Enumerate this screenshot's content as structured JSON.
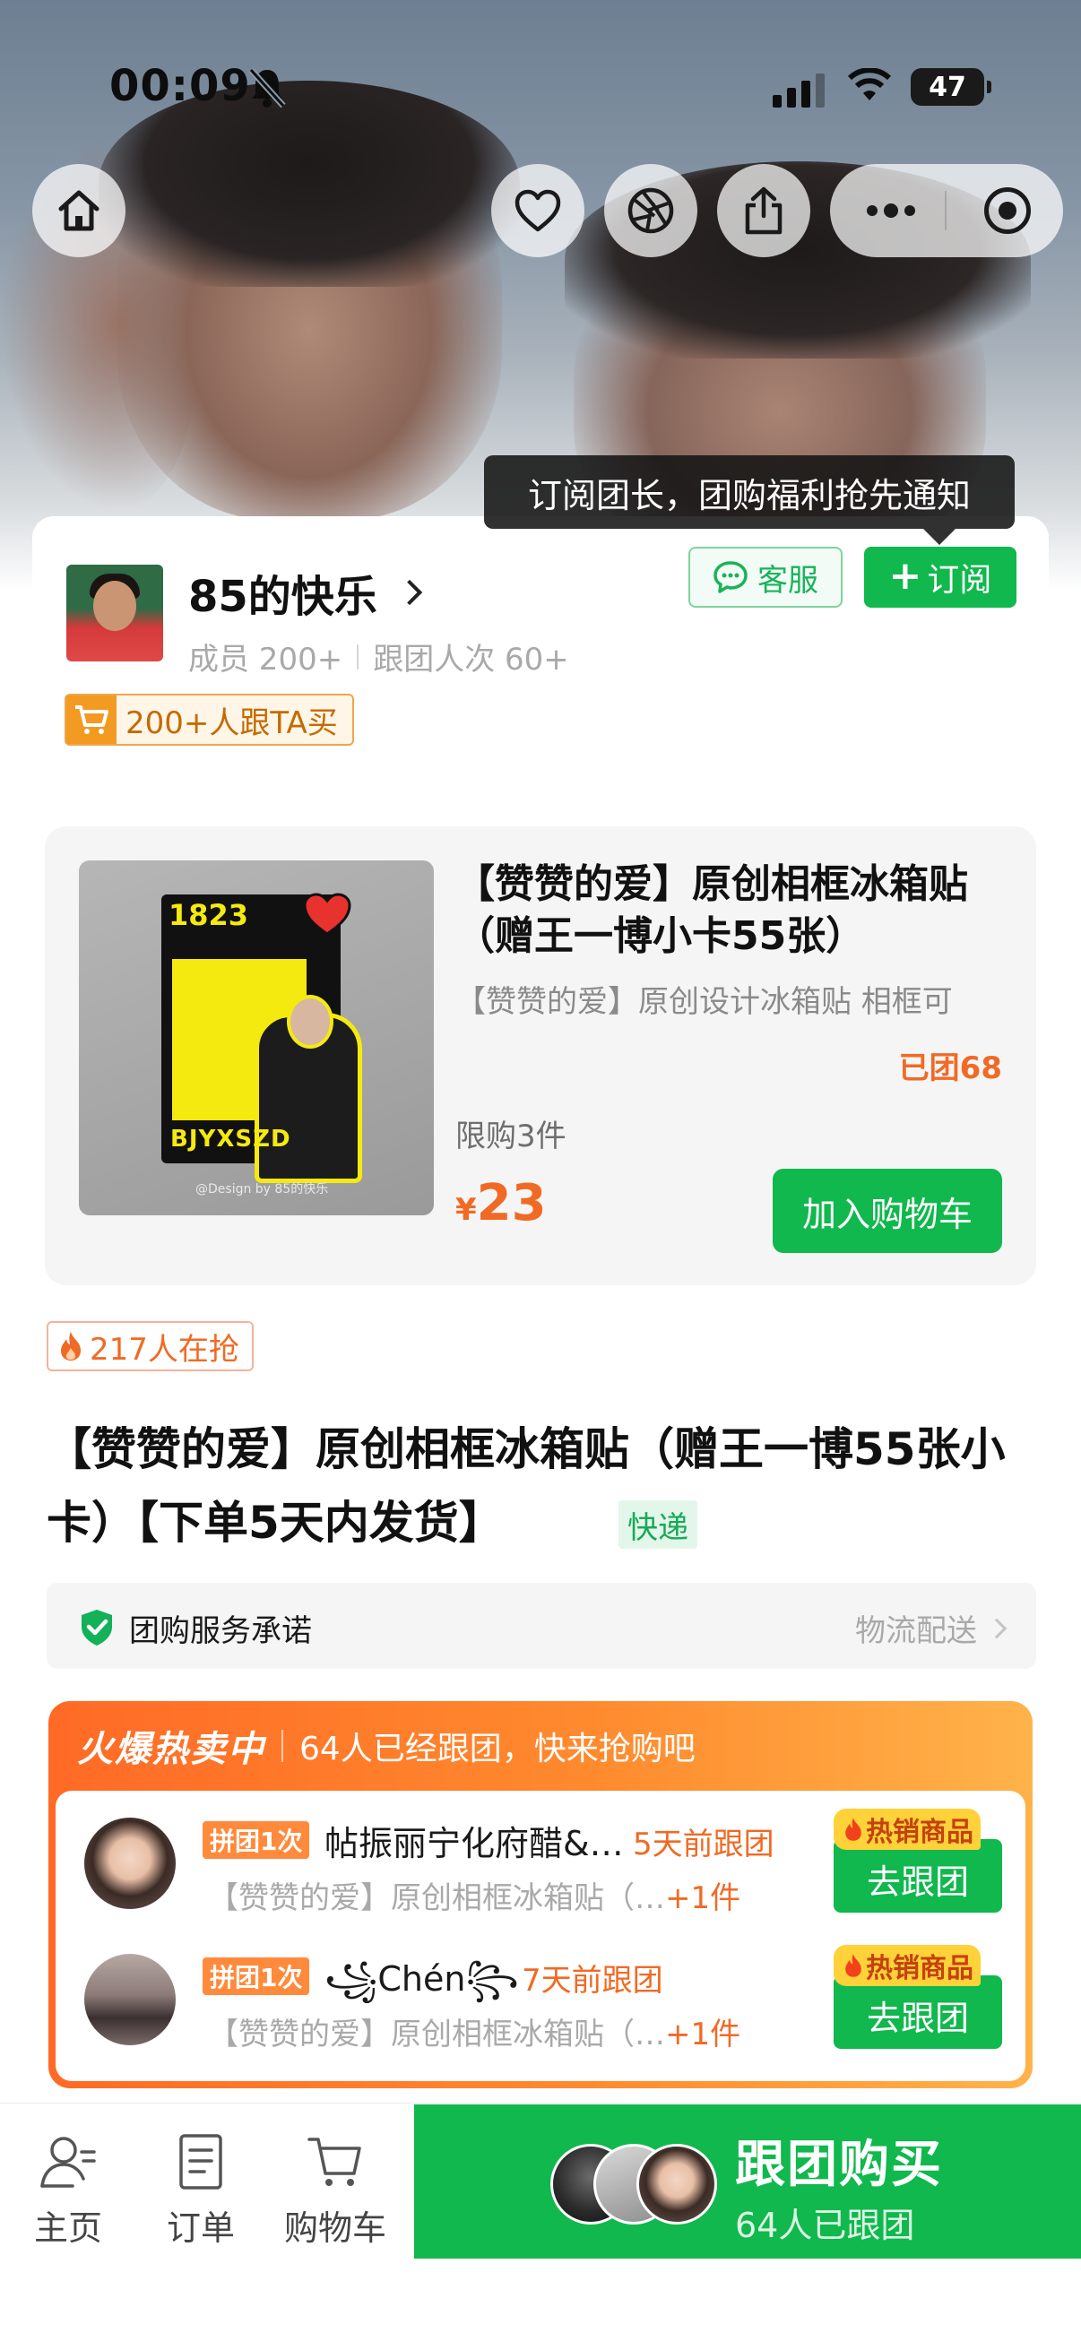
{
  "status_bar": {
    "time": "00:09",
    "battery": "47"
  },
  "tooltip": "订阅团长，团购福利抢先通知",
  "leader": {
    "name": "85的快乐",
    "members": "成员 200+",
    "followers": "跟团人次 60+",
    "buy_badge": "200+人跟TA买",
    "service_label": "客服",
    "subscribe_label": "订阅"
  },
  "product": {
    "thumb_text": {
      "year": "1823",
      "bottom": "BJYXSZD",
      "credit": "@Design by 85的快乐"
    },
    "title": "【赞赞的爱】原创相框冰箱贴（赠王一博小卡55张）",
    "desc": "【赞赞的爱】原创设计冰箱贴 相框可",
    "sold": "已团68",
    "limit": "限购3件",
    "price_symbol": "¥",
    "price": "23",
    "add_cart_label": "加入购物车"
  },
  "grabbing": "217人在抢",
  "main_title": "【赞赞的爱】原创相框冰箱贴（赠王一博55张小卡）【下单5天内发货】",
  "express_tag": "快递",
  "service": {
    "label": "团购服务承诺",
    "right": "物流配送"
  },
  "hot_sale": {
    "brand": "火爆热卖中",
    "info": "64人已经跟团，快来抢购吧",
    "rows": [
      {
        "tag": "拼团1次",
        "nickname": "帖振丽宁化府醋&…",
        "when": "5天前跟团",
        "item": "【赞赞的爱】原创相框冰箱贴（…",
        "more": "+1件",
        "hot": "热销商品",
        "join": "去跟团"
      },
      {
        "tag": "拼团1次",
        "nickname": "꧁Chén꧂",
        "when": "7天前跟团",
        "item": "【赞赞的爱】原创相框冰箱贴（…",
        "more": "+1件",
        "hot": "热销商品",
        "join": "去跟团"
      }
    ]
  },
  "bottom_bar": {
    "tabs": [
      {
        "label": "主页"
      },
      {
        "label": "订单"
      },
      {
        "label": "购物车"
      }
    ],
    "buy_title": "跟团购买",
    "buy_sub": "64人已跟团"
  },
  "colors": {
    "brand_green": "#10b84d",
    "accent_orange": "#f06a25"
  }
}
